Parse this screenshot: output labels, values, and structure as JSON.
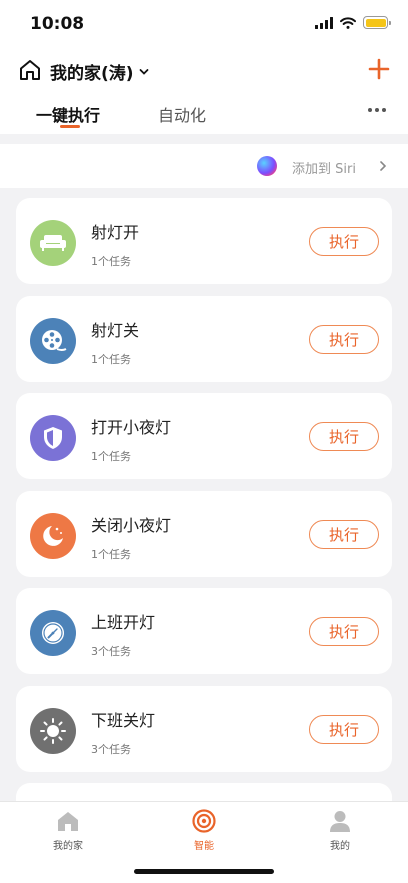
{
  "status_bar": {
    "time": "10:08"
  },
  "header": {
    "title": "我的家(涛)"
  },
  "tabs": [
    {
      "label": "一键执行"
    },
    {
      "label": "自动化"
    }
  ],
  "siri": {
    "label": "添加到 Siri"
  },
  "scenes": [
    {
      "name": "射灯开",
      "tasks": "1个任务",
      "action": "执行",
      "icon": "sofa-icon",
      "color": "#a4d27a"
    },
    {
      "name": "射灯关",
      "tasks": "1个任务",
      "action": "执行",
      "icon": "film-reel-icon",
      "color": "#4c82b8"
    },
    {
      "name": "打开小夜灯",
      "tasks": "1个任务",
      "action": "执行",
      "icon": "shield-icon",
      "color": "#7b72d6"
    },
    {
      "name": "关闭小夜灯",
      "tasks": "1个任务",
      "action": "执行",
      "icon": "moon-icon",
      "color": "#ee7845"
    },
    {
      "name": "上班开灯",
      "tasks": "3个任务",
      "action": "执行",
      "icon": "clock-icon",
      "color": "#4c82b8"
    },
    {
      "name": "下班关灯",
      "tasks": "3个任务",
      "action": "执行",
      "icon": "sun-icon",
      "color": "#707070"
    }
  ],
  "tabbar": [
    {
      "label": "我的家",
      "icon": "home-icon"
    },
    {
      "label": "智能",
      "icon": "smart-icon",
      "active": true
    },
    {
      "label": "我的",
      "icon": "user-icon"
    }
  ],
  "colors": {
    "accent": "#e9642a",
    "background": "#f2f2f4"
  }
}
